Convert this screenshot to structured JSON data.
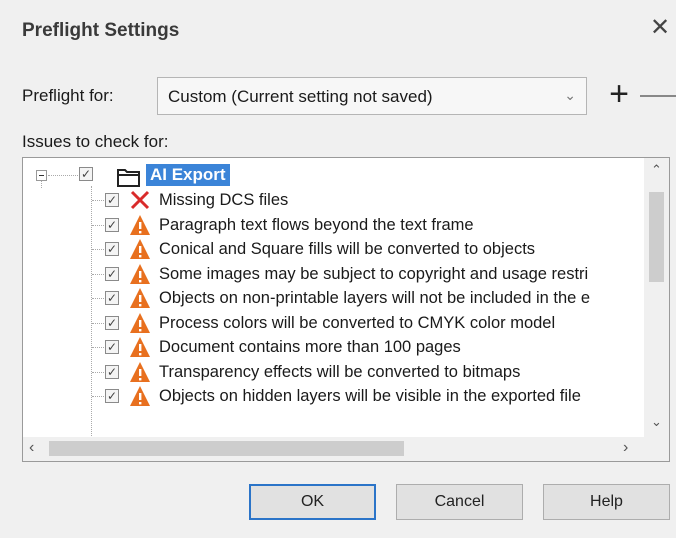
{
  "window": {
    "title": "Preflight Settings",
    "close_glyph": "✕"
  },
  "preflight_for": {
    "label": "Preflight for:",
    "value": "Custom (Current setting not saved)"
  },
  "toolbar": {
    "add_glyph": "+"
  },
  "issues": {
    "label": "Issues to check for:",
    "root": {
      "label": "AI Export",
      "checked": true
    },
    "items": [
      {
        "icon": "error-x-icon",
        "checked": true,
        "text": "Missing DCS files"
      },
      {
        "icon": "warning-icon",
        "checked": true,
        "text": "Paragraph text flows beyond the text frame"
      },
      {
        "icon": "warning-icon",
        "checked": true,
        "text": "Conical and Square fills will be converted to objects"
      },
      {
        "icon": "warning-icon",
        "checked": true,
        "text": "Some images may be subject to copyright and usage restri"
      },
      {
        "icon": "warning-icon",
        "checked": true,
        "text": "Objects on non-printable layers will not be included in the e"
      },
      {
        "icon": "warning-icon",
        "checked": true,
        "text": "Process colors will be converted to CMYK color model"
      },
      {
        "icon": "warning-icon",
        "checked": true,
        "text": "Document contains more than 100 pages"
      },
      {
        "icon": "warning-icon",
        "checked": true,
        "text": "Transparency effects will be converted to bitmaps"
      },
      {
        "icon": "warning-icon",
        "checked": true,
        "text": "Objects on hidden layers will be visible in the exported file"
      }
    ]
  },
  "buttons": {
    "ok": "OK",
    "cancel": "Cancel",
    "help": "Help"
  },
  "colors": {
    "accent": "#3b84d8",
    "warning": "#e8701f",
    "error": "#d92b2b"
  }
}
